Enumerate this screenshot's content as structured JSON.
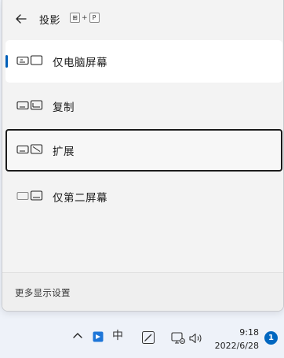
{
  "flyout": {
    "title": "投影",
    "shortcut": {
      "key1": "⊞",
      "plus": "+",
      "key2": "P"
    },
    "options": [
      {
        "label": "仅电脑屏幕",
        "icon": "pc-screen-only-icon",
        "selected": true
      },
      {
        "label": "复制",
        "icon": "duplicate-icon"
      },
      {
        "label": "扩展",
        "icon": "extend-icon",
        "focused": true
      },
      {
        "label": "仅第二屏幕",
        "icon": "second-screen-only-icon"
      }
    ],
    "footer_link": "更多显示设置"
  },
  "taskbar": {
    "ime_label": "中",
    "time": "9:18",
    "date": "2022/6/28",
    "notification_count": "1"
  },
  "colors": {
    "accent": "#005fb8",
    "badge": "#0067c0"
  }
}
